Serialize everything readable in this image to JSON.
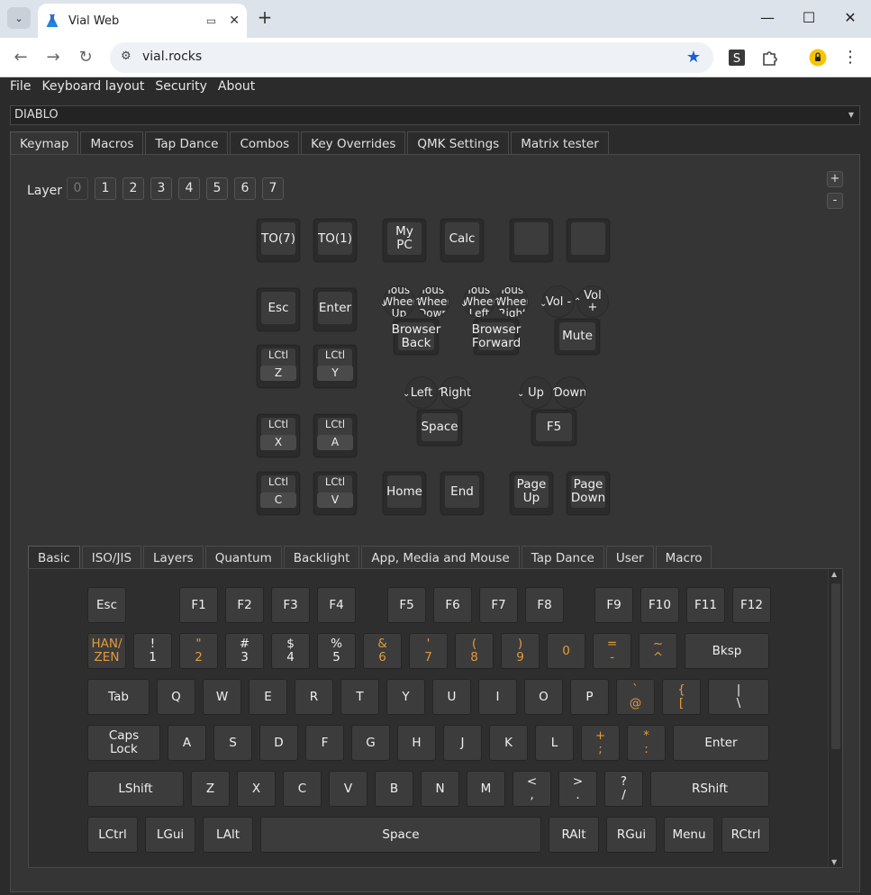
{
  "browser": {
    "tab_title": "Vial Web",
    "url": "vial.rocks",
    "new_tab": "+",
    "minimize": "—",
    "maximize": "☐",
    "close": "✕"
  },
  "menu": [
    "File",
    "Keyboard layout",
    "Security",
    "About"
  ],
  "device": "DIABLO",
  "top_tabs": [
    "Keymap",
    "Macros",
    "Tap Dance",
    "Combos",
    "Key Overrides",
    "QMK Settings",
    "Matrix tester"
  ],
  "zoom": {
    "plus": "+",
    "minus": "-"
  },
  "layer": {
    "label": "Layer",
    "numbers": [
      "0",
      "1",
      "2",
      "3",
      "4",
      "5",
      "6",
      "7"
    ],
    "active": "0"
  },
  "keymap": {
    "k_to7": "TO(7)",
    "k_to1": "TO(1)",
    "k_mypc": "My PC",
    "k_calc": "Calc",
    "k_esc": "Esc",
    "k_enter": "Enter",
    "k_lctl_z": {
      "mod": "LCtl",
      "key": "Z"
    },
    "k_lctl_y": {
      "mod": "LCtl",
      "key": "Y"
    },
    "k_lctl_x": {
      "mod": "LCtl",
      "key": "X"
    },
    "k_lctl_a": {
      "mod": "LCtl",
      "key": "A"
    },
    "k_lctl_c": {
      "mod": "LCtl",
      "key": "C"
    },
    "k_lctl_v": {
      "mod": "LCtl",
      "key": "V"
    },
    "k_home": "Home",
    "k_end": "End",
    "k_pgup": "Page Up",
    "k_pgdn": "Page Down",
    "enc1": {
      "ccw": "Mouse Wheel Up",
      "cw": "Mouse Wheel Down",
      "press": "Browser Back"
    },
    "enc2": {
      "ccw": "Mouse Wheel Left",
      "cw": "Mouse Wheel Right",
      "press": "Browser Forward"
    },
    "enc3": {
      "ccw": "Vol -",
      "cw": "Vol +",
      "press": "Mute"
    },
    "enc4": {
      "ccw": "Left",
      "cw": "Right",
      "press": "Space"
    },
    "enc5": {
      "ccw": "Up",
      "cw": "Down",
      "press": "F5"
    }
  },
  "bottom_tabs": [
    "Basic",
    "ISO/JIS",
    "Layers",
    "Quantum",
    "Backlight",
    "App, Media and Mouse",
    "Tap Dance",
    "User",
    "Macro"
  ],
  "basic_keys": {
    "row1": [
      "Esc",
      "F1",
      "F2",
      "F3",
      "F4",
      "F5",
      "F6",
      "F7",
      "F8",
      "F9",
      "F10",
      "F11",
      "F12"
    ],
    "row2": [
      [
        "HAN/",
        "ZEN"
      ],
      [
        "!",
        "1"
      ],
      [
        "\"",
        "2"
      ],
      [
        "#",
        "3"
      ],
      [
        "$",
        "4"
      ],
      [
        "%",
        "5"
      ],
      [
        "&",
        "6"
      ],
      [
        "'",
        "7"
      ],
      [
        "(",
        "8"
      ],
      [
        ")",
        "9"
      ],
      [
        "",
        "0"
      ],
      [
        "=",
        "-"
      ],
      [
        "~",
        "^"
      ],
      [
        "Bksp",
        ""
      ]
    ],
    "row3": [
      [
        "Tab",
        ""
      ],
      [
        "Q",
        ""
      ],
      [
        "W",
        ""
      ],
      [
        "E",
        ""
      ],
      [
        "R",
        ""
      ],
      [
        "T",
        ""
      ],
      [
        "Y",
        ""
      ],
      [
        "U",
        ""
      ],
      [
        "I",
        ""
      ],
      [
        "O",
        ""
      ],
      [
        "P",
        ""
      ],
      [
        "`",
        "@"
      ],
      [
        "{",
        "["
      ],
      [
        "|",
        "\\"
      ]
    ],
    "row4": [
      [
        "Caps",
        "Lock"
      ],
      [
        "A",
        ""
      ],
      [
        "S",
        ""
      ],
      [
        "D",
        ""
      ],
      [
        "F",
        ""
      ],
      [
        "G",
        ""
      ],
      [
        "H",
        ""
      ],
      [
        "J",
        ""
      ],
      [
        "K",
        ""
      ],
      [
        "L",
        ""
      ],
      [
        "+",
        ";"
      ],
      [
        "*",
        ":"
      ],
      [
        "Enter",
        ""
      ]
    ],
    "row5": [
      [
        "LShift",
        ""
      ],
      [
        "Z",
        ""
      ],
      [
        "X",
        ""
      ],
      [
        "C",
        ""
      ],
      [
        "V",
        ""
      ],
      [
        "B",
        ""
      ],
      [
        "N",
        ""
      ],
      [
        "M",
        ""
      ],
      [
        "<",
        ","
      ],
      [
        ">",
        "."
      ],
      [
        "?",
        "/"
      ],
      [
        "RShift",
        ""
      ]
    ],
    "row6": [
      [
        "LCtrl",
        ""
      ],
      [
        "LGui",
        ""
      ],
      [
        "LAlt",
        ""
      ],
      [
        "Space",
        ""
      ],
      [
        "RAlt",
        ""
      ],
      [
        "RGui",
        ""
      ],
      [
        "Menu",
        ""
      ],
      [
        "RCtrl",
        ""
      ]
    ]
  },
  "colors": {
    "accent_orange": "#e39a3b",
    "star_blue": "#1a5fd6"
  }
}
